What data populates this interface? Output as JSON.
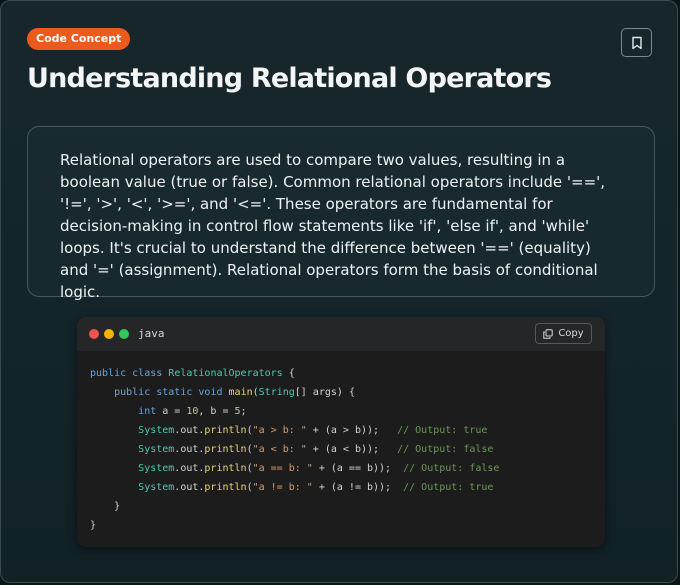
{
  "badge": "Code Concept",
  "title": "Understanding Relational Operators",
  "description": "Relational operators are used to compare two values, resulting in a boolean value (true or false). Common relational operators include '==', '!=', '>', '<', '>=', and '<='. These operators are fundamental for decision-making in control flow statements like 'if', 'else if', and 'while' loops. It's crucial to understand the difference between '==' (equality) and '=' (assignment). Relational operators form the basis of conditional logic.",
  "bookmark_icon": "bookmark-icon",
  "code_block": {
    "language": "java",
    "copy_label": "Copy",
    "copy_icon": "copy-icon",
    "lines": [
      "public class RelationalOperators {",
      "    public static void main(String[] args) {",
      "        int a = 10, b = 5;",
      "        System.out.println(\"a > b: \" + (a > b));   // Output: true",
      "        System.out.println(\"a < b: \" + (a < b));   // Output: false",
      "        System.out.println(\"a == b: \" + (a == b));  // Output: false",
      "        System.out.println(\"a != b: \" + (a != b));  // Output: true",
      "    }",
      "}"
    ]
  },
  "colors": {
    "badge": "#ec5a1c",
    "background": "#13252a",
    "code_background": "#1c1c1c"
  }
}
